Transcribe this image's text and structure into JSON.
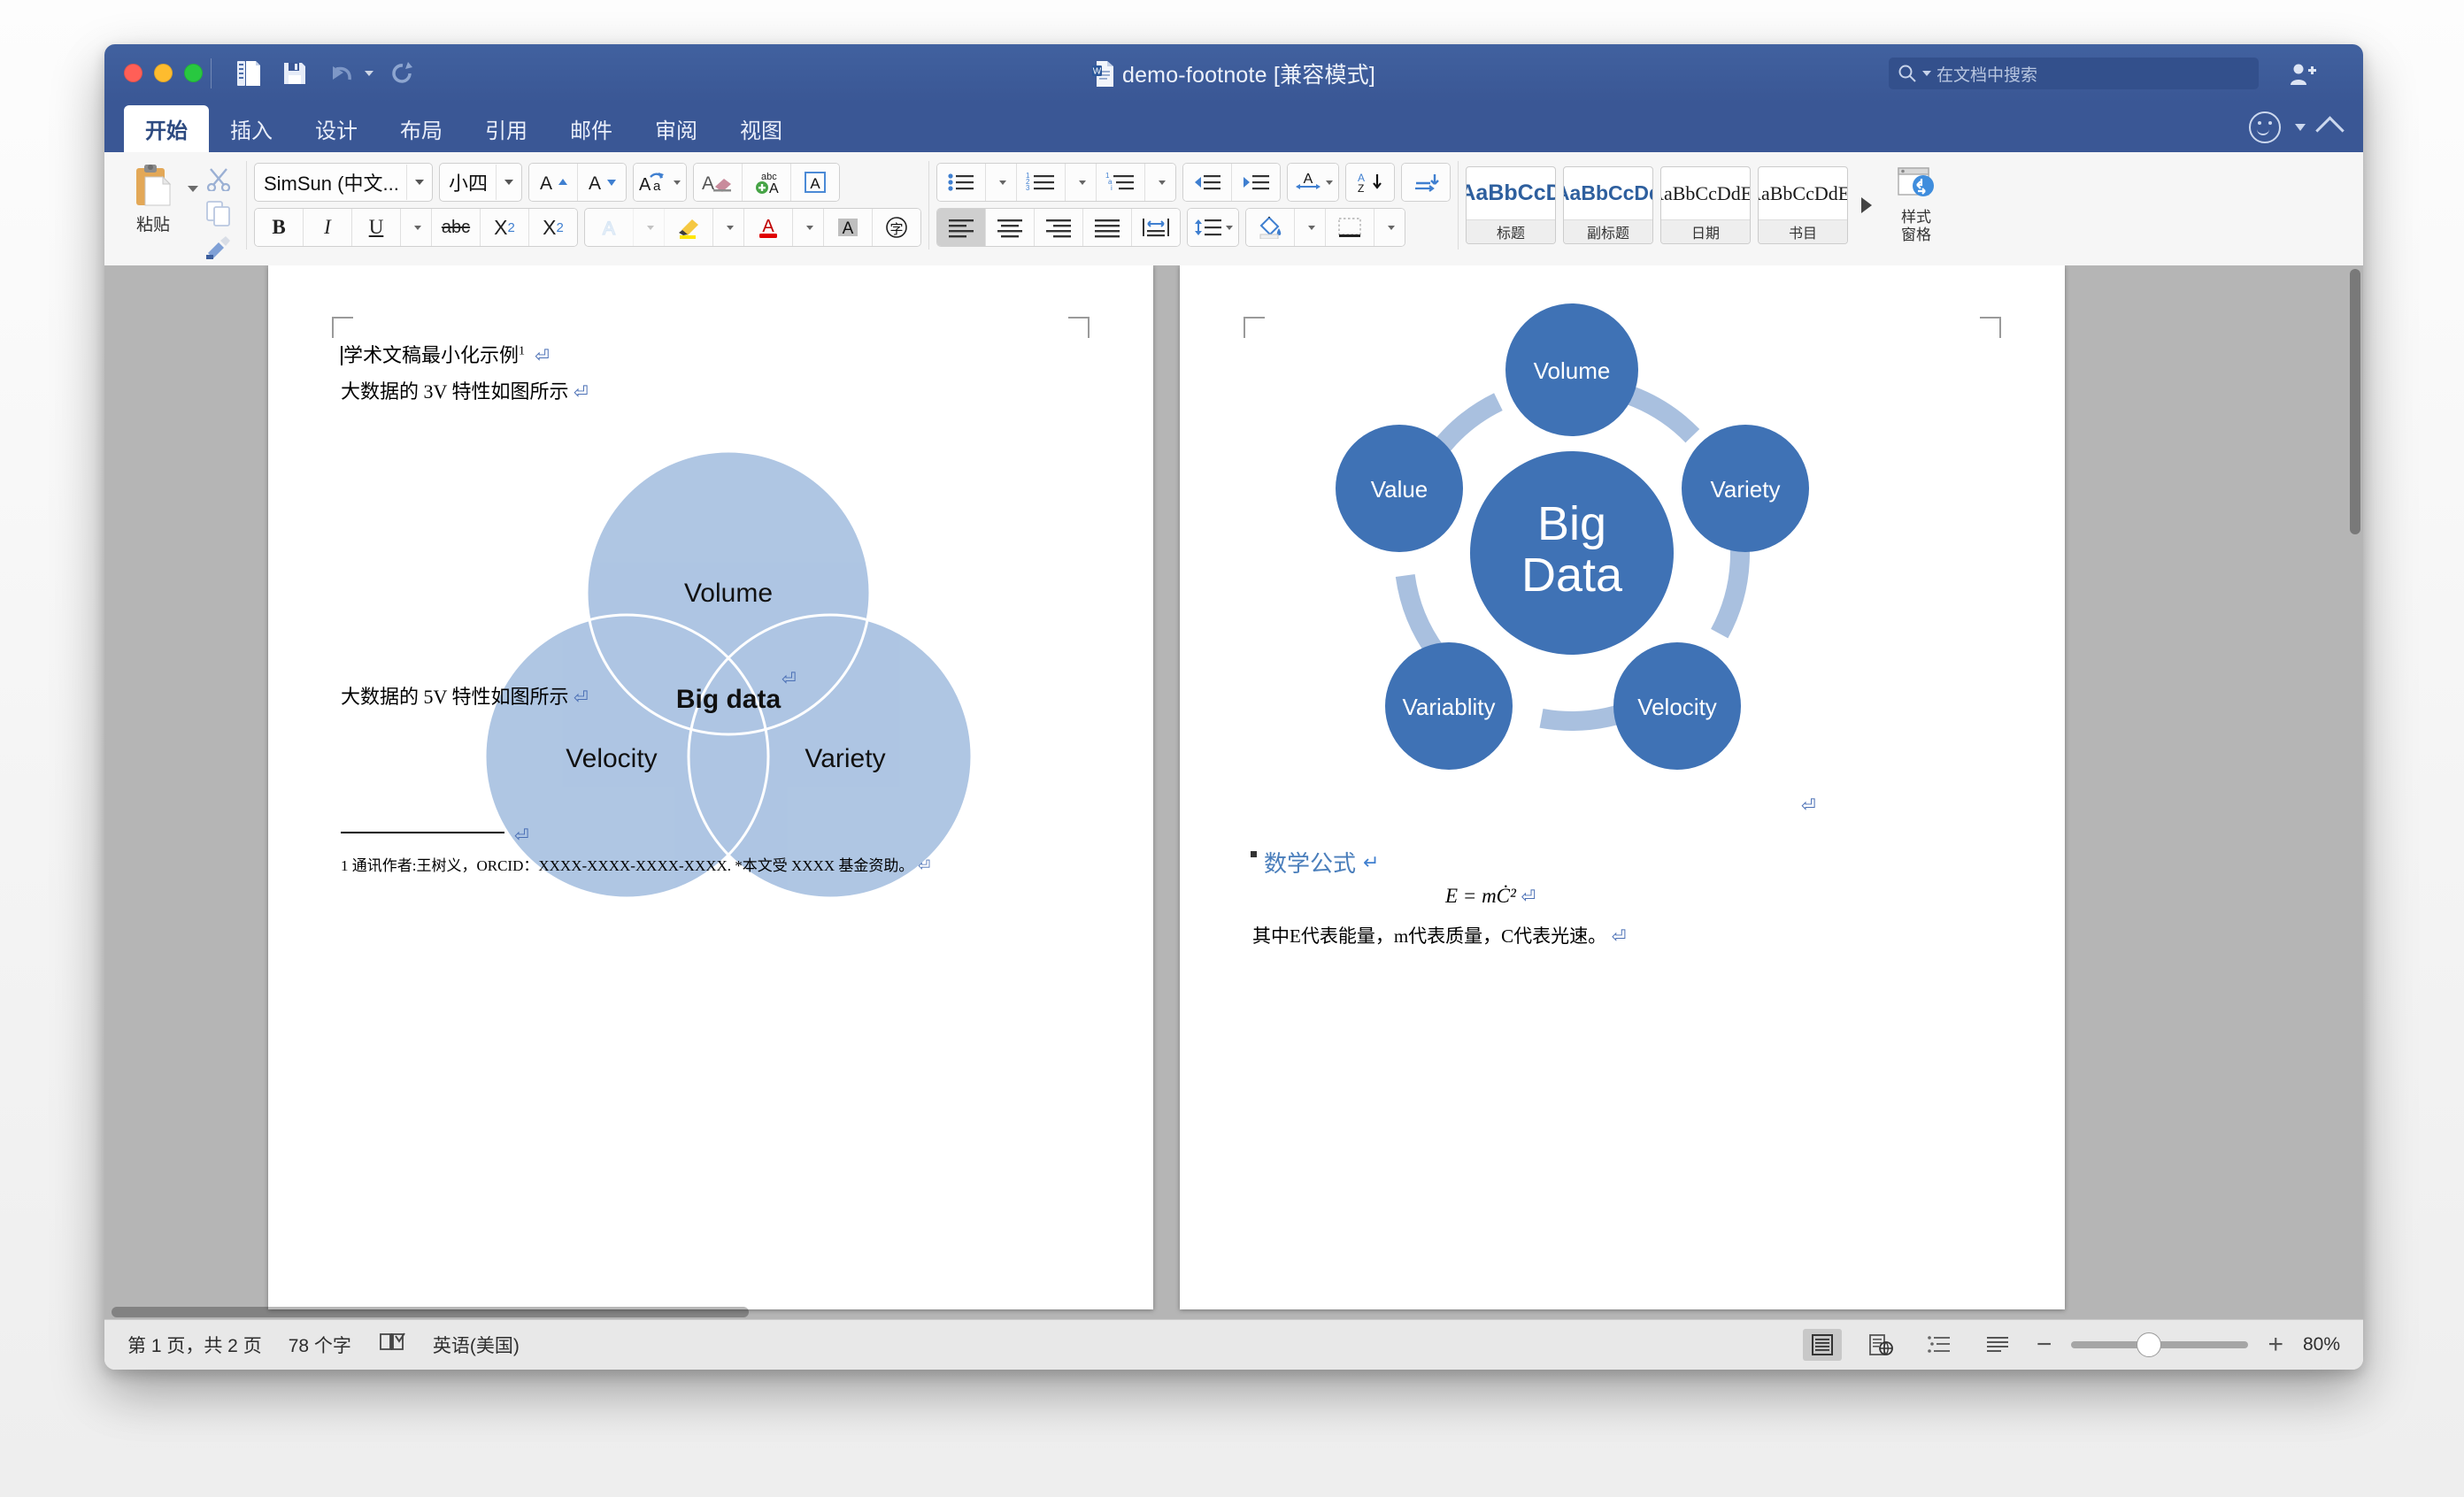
{
  "window": {
    "title": "demo-footnote [兼容模式]",
    "traffic": [
      "close-button",
      "minimize-button",
      "maximize-button"
    ]
  },
  "quick_access": {
    "items": [
      {
        "name": "print-layout-toggle",
        "icon": "document-panel-icon"
      },
      {
        "name": "save-button",
        "icon": "floppy-disk-icon"
      },
      {
        "name": "undo-button",
        "icon": "undo-arrow-icon"
      },
      {
        "name": "redo-button",
        "icon": "redo-arrow-icon"
      }
    ]
  },
  "search": {
    "placeholder": "在文档中搜索",
    "icon": "search-icon"
  },
  "share": {
    "icon": "person-add-icon"
  },
  "tabs": [
    {
      "label": "开始",
      "active": true
    },
    {
      "label": "插入",
      "active": false
    },
    {
      "label": "设计",
      "active": false
    },
    {
      "label": "布局",
      "active": false
    },
    {
      "label": "引用",
      "active": false
    },
    {
      "label": "邮件",
      "active": false
    },
    {
      "label": "审阅",
      "active": false
    },
    {
      "label": "视图",
      "active": false
    }
  ],
  "ribbon": {
    "clipboard": {
      "paste_label": "粘贴",
      "cut": "cut-scissors-icon",
      "copy": "copy-icon",
      "format_painter": "format-painter-icon"
    },
    "font": {
      "font_name": "SimSun (中文...",
      "font_size": "小四",
      "grow_font": "A▲",
      "shrink_font": "A▼",
      "change_case": "Aa",
      "clear_formatting": "clear-formatting-icon",
      "phonetic_guide": "phonetic-guide-icon",
      "character_border": "A",
      "bold": "B",
      "italic": "I",
      "underline": "U",
      "strikethrough": "abc",
      "subscript": "X₂",
      "superscript": "X²",
      "text_effects": "A",
      "highlight": "highlight-icon",
      "font_color": "A",
      "shading": "A",
      "character_shading": "字"
    },
    "paragraph": {
      "bullets": "bullet-list-icon",
      "numbering": "numbered-list-icon",
      "multilevel": "multilevel-list-icon",
      "decrease_indent": "decrease-indent-icon",
      "increase_indent": "increase-indent-icon",
      "text_direction": "text-direction-icon",
      "sort": "sort-az-icon",
      "show_marks": "show-formatting-marks-icon",
      "align_left": "align-left-icon",
      "align_center": "align-center-icon",
      "align_right": "align-right-icon",
      "justify": "justify-icon",
      "distribute": "distribute-icon",
      "line_spacing": "line-spacing-icon",
      "shading_fill": "shading-bucket-icon",
      "borders": "borders-icon"
    },
    "styles": {
      "gallery": [
        {
          "preview": "AaBbCcD",
          "name": "标题",
          "style": "heading"
        },
        {
          "preview": "AaBbCcDd",
          "name": "副标题",
          "style": "subheading"
        },
        {
          "preview": "AaBbCcDdEe",
          "name": "日期",
          "style": "serif"
        },
        {
          "preview": "AaBbCcDdEe",
          "name": "书目",
          "style": "serif"
        }
      ],
      "scroll_icon": "gallery-scroll-right-icon",
      "pane_label_line1": "样式",
      "pane_label_line2": "窗格"
    }
  },
  "document": {
    "page1": {
      "line1": "学术文稿最小化示例",
      "line1_sup": "1",
      "line2": "大数据的 3V 特性如图所示",
      "line3": "大数据的 5V 特性如图所示",
      "footnote": "1 通讯作者:王树义，ORCID：XXXX-XXXX-XXXX-XXXX. *本文受 XXXX 基金资助。",
      "venn": {
        "top": "Volume",
        "left": "Velocity",
        "right": "Variety",
        "center": "Big data"
      }
    },
    "page2": {
      "heading": "数学公式",
      "formula": "E = mĊ²",
      "explanation": "其中E代表能量，m代表质量，C代表光速。",
      "cycle": {
        "center_line1": "Big",
        "center_line2": "Data",
        "nodes": [
          "Volume",
          "Variety",
          "Velocity",
          "Variablity",
          "Value"
        ]
      }
    }
  },
  "status_bar": {
    "page_info": "第 1 页，共 2 页",
    "word_count": "78 个字",
    "proofing_icon": "spell-check-icon",
    "language": "英语(美国)",
    "views": [
      {
        "name": "print-layout-view",
        "icon": "print-layout-icon",
        "selected": true
      },
      {
        "name": "web-layout-view",
        "icon": "web-layout-icon",
        "selected": false
      },
      {
        "name": "outline-view",
        "icon": "outline-icon",
        "selected": false
      },
      {
        "name": "draft-view",
        "icon": "draft-icon",
        "selected": false
      }
    ],
    "zoom_out": "−",
    "zoom_in": "+",
    "zoom_level": "80%"
  },
  "colors": {
    "titlebar": "#3a5795",
    "accent": "#4172b8",
    "venn_fill": "#a8c0e0",
    "cycle_fill": "#3f72b5",
    "heading_blue": "#4a7ebb"
  }
}
